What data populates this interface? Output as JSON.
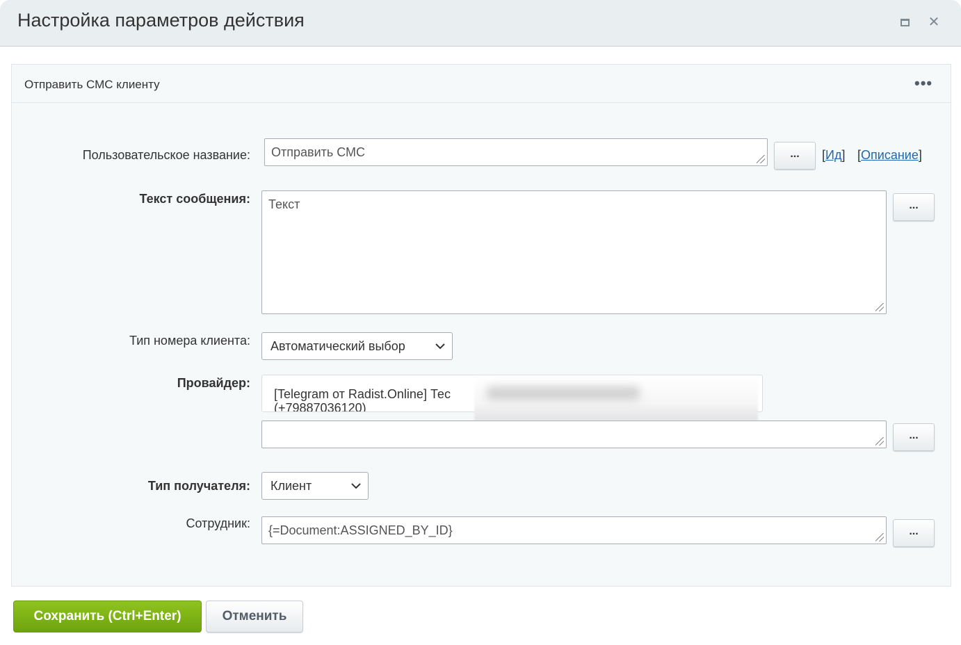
{
  "dialog": {
    "title": "Настройка параметров действия",
    "maximize_icon": "maximize-icon",
    "close_icon": "close-icon",
    "close_glyph": "✕"
  },
  "panel": {
    "title": "Отправить СМС клиенту",
    "menu_glyph": "•••"
  },
  "form": {
    "custom_name": {
      "label": "Пользовательское название:",
      "value": "Отправить СМС",
      "dots": "...",
      "id_link": "Ид",
      "description_link": "Описание",
      "bracket_open": "[",
      "bracket_close": "]"
    },
    "message_text": {
      "label": "Текст сообщения:",
      "value": "Текст",
      "dots": "..."
    },
    "client_number_type": {
      "label": "Тип номера клиента:",
      "selected": "Автоматический выбор"
    },
    "provider": {
      "label": "Провайдер:",
      "selected_line1": "[Telegram от Radist.Online] Тес",
      "selected_line2": "(+79887036120)",
      "extra_value": "",
      "dots": "..."
    },
    "recipient_type": {
      "label": "Тип получателя:",
      "selected": "Клиент"
    },
    "employee": {
      "label": "Сотрудник:",
      "value": "{=Document:ASSIGNED_BY_ID}",
      "dots": "..."
    }
  },
  "footer": {
    "save_label": "Сохранить (Ctrl+Enter)",
    "cancel_label": "Отменить"
  },
  "colors": {
    "save_green": "#7ab317",
    "link_blue": "#2067b0",
    "titlebar_bg": "#e9eef1",
    "panel_bg": "#f5f9fa"
  }
}
